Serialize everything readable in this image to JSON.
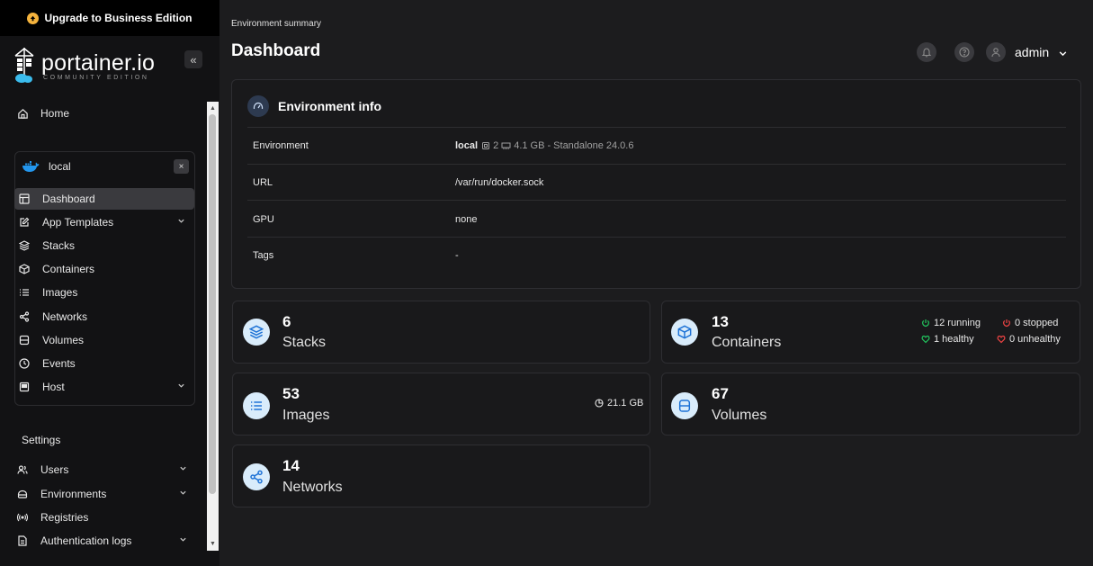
{
  "sidebar": {
    "upgrade_label": "Upgrade to Business Edition",
    "logo_name": "portainer.io",
    "logo_sub": "COMMUNITY EDITION",
    "collapse_label": "«",
    "home_label": "Home",
    "environment": {
      "name": "local",
      "close_label": "×",
      "items": [
        {
          "label": "Dashboard",
          "icon": "layout-icon",
          "active": true
        },
        {
          "label": "App Templates",
          "icon": "edit-icon",
          "expandable": true
        },
        {
          "label": "Stacks",
          "icon": "layers-icon"
        },
        {
          "label": "Containers",
          "icon": "box-icon"
        },
        {
          "label": "Images",
          "icon": "list-icon"
        },
        {
          "label": "Networks",
          "icon": "share-icon"
        },
        {
          "label": "Volumes",
          "icon": "database-icon"
        },
        {
          "label": "Events",
          "icon": "clock-icon"
        },
        {
          "label": "Host",
          "icon": "server-icon",
          "expandable": true
        }
      ]
    },
    "settings_label": "Settings",
    "settings_items": [
      {
        "label": "Users",
        "icon": "users-icon",
        "expandable": true
      },
      {
        "label": "Environments",
        "icon": "plug-icon",
        "expandable": true
      },
      {
        "label": "Registries",
        "icon": "radio-icon"
      },
      {
        "label": "Authentication logs",
        "icon": "file-text-icon",
        "expandable": true
      }
    ]
  },
  "header": {
    "breadcrumb": "Environment summary",
    "title": "Dashboard",
    "user": "admin"
  },
  "env_info": {
    "title": "Environment info",
    "rows": [
      {
        "label": "Environment",
        "value": "local",
        "cpu": "2",
        "memory": "4.1 GB",
        "detail": "- Standalone 24.0.6"
      },
      {
        "label": "URL",
        "value": "/var/run/docker.sock"
      },
      {
        "label": "GPU",
        "value": "none"
      },
      {
        "label": "Tags",
        "value": "-"
      }
    ]
  },
  "stats": {
    "stacks": {
      "count": "6",
      "label": "Stacks"
    },
    "containers": {
      "count": "13",
      "label": "Containers",
      "running": "12 running",
      "stopped": "0 stopped",
      "healthy": "1 healthy",
      "unhealthy": "0 unhealthy"
    },
    "images": {
      "count": "53",
      "label": "Images",
      "size": "21.1 GB"
    },
    "volumes": {
      "count": "67",
      "label": "Volumes"
    },
    "networks": {
      "count": "14",
      "label": "Networks"
    }
  },
  "colors": {
    "accent_blue": "#3b82f6",
    "stat_icon_bg": "#d9ecfb",
    "running_green": "#22c55e",
    "stopped_red": "#ef4444",
    "upgrade_yellow": "#f4b33d"
  }
}
